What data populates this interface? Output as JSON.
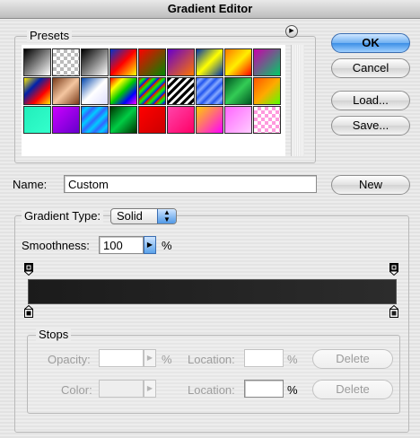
{
  "window": {
    "title": "Gradient Editor"
  },
  "presets": {
    "label": "Presets",
    "swatches": [
      "linear-gradient(135deg,#000,#fff)",
      "repeating-conic-gradient(#bbb 0% 25%,#fff 0% 50%) 0 0/8px 8px",
      "linear-gradient(135deg,#000,#fff)",
      "linear-gradient(135deg,#0033cc,#ff0000,#ffff00)",
      "linear-gradient(135deg,#ff0000,#008800)",
      "linear-gradient(135deg,#6600cc,#ff7700)",
      "linear-gradient(135deg,#0033aa,#ffff00,#0033aa)",
      "linear-gradient(135deg,#ff7700,#ffee00,#ff0000)",
      "linear-gradient(135deg,#cc00aa,#00cc66)",
      "linear-gradient(135deg,#ffee00,#0022aa,#ff0000,#ffee00)",
      "linear-gradient(135deg,#7a3b1a,#f4c6a0,#7a3b1a)",
      "linear-gradient(135deg,#0044aa,#ffffff,#ddddff)",
      "linear-gradient(135deg,#ff0000,#ffff00,#00cc00,#0000ff,#ff00ff)",
      "repeating-linear-gradient(135deg,#ff0000 0,#00ff00 4px,#0000ff 8px)",
      "repeating-linear-gradient(135deg,#000 0,#000 3px,#fff 3px,#fff 6px)",
      "repeating-linear-gradient(135deg,#2255ee 0,#88aaff 4px,#2255ee 8px)",
      "linear-gradient(135deg,#005522,#33cc55,#005522)",
      "linear-gradient(135deg,#ff5500,#ffaa00,#55ff00)",
      "linear-gradient(135deg,#22eebb,#33ffcc)",
      "linear-gradient(135deg,#cc00ff,#6600cc)",
      "repeating-linear-gradient(135deg,#3366ff 0,#00ccff 5px,#3366ff 10px)",
      "linear-gradient(135deg,#003300,#00cc44,#003300)",
      "linear-gradient(135deg,#ff0000,#cc0000)",
      "linear-gradient(135deg,#ff44aa,#ff0066)",
      "linear-gradient(135deg,#ffcc00,#ff00ff)",
      "linear-gradient(135deg,#ff66ff,#ffccff)",
      "repeating-conic-gradient(#ff99dd 0% 25%,#fff 0% 50%) 0 0/8px 8px"
    ]
  },
  "buttons": {
    "ok": "OK",
    "cancel": "Cancel",
    "load": "Load...",
    "save": "Save...",
    "new": "New",
    "delete1": "Delete",
    "delete2": "Delete"
  },
  "name": {
    "label": "Name:",
    "value": "Custom"
  },
  "gradient": {
    "type_label": "Gradient Type:",
    "type_value": "Solid",
    "smoothness_label": "Smoothness:",
    "smoothness_value": "100",
    "percent": "%"
  },
  "stops": {
    "label": "Stops",
    "opacity_label": "Opacity:",
    "color_label": "Color:",
    "location_label": "Location:",
    "location_label2": "Location:",
    "percent": "%"
  }
}
